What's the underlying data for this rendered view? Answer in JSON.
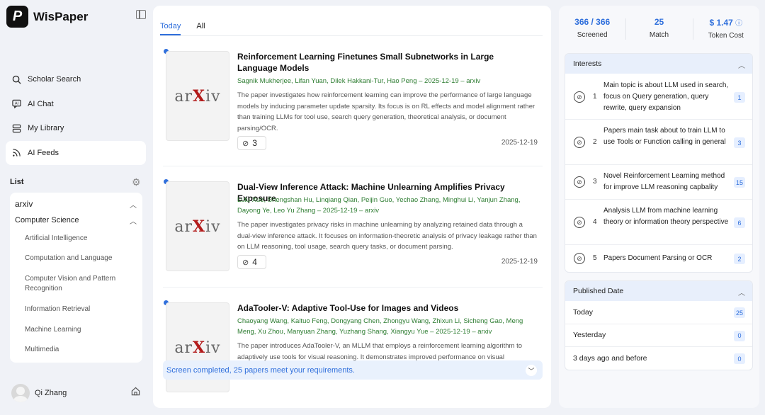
{
  "brand": {
    "logo_letter": "P",
    "name": "WisPaper"
  },
  "nav": [
    {
      "label": "Scholar Search",
      "icon": "search-icon"
    },
    {
      "label": "AI Chat",
      "icon": "chat-icon"
    },
    {
      "label": "My Library",
      "icon": "library-icon"
    },
    {
      "label": "AI Feeds",
      "icon": "rss-icon",
      "active": true
    }
  ],
  "list": {
    "heading": "List",
    "source": "arxiv",
    "category": "Computer Science",
    "subcategories": [
      "Artificial Intelligence",
      "Computation and Language",
      "Computer Vision and Pattern Recognition",
      "Information Retrieval",
      "Machine Learning",
      "Multimedia"
    ]
  },
  "user": {
    "name": "Qi Zhang"
  },
  "tabs": [
    {
      "label": "Today",
      "active": true
    },
    {
      "label": "All",
      "active": false
    }
  ],
  "papers": [
    {
      "thumb": {
        "ar": "ar",
        "x": "X",
        "iv": "iv"
      },
      "title": "Reinforcement Learning Finetunes Small Subnetworks in Large Language Models",
      "authors": "Sagnik Mukherjee, Lifan Yuan, Dilek Hakkani-Tur, Hao Peng – 2025-12-19 – arxiv",
      "abstract": "The paper investigates how reinforcement learning can improve the performance of large language models by inducing parameter update sparsity. Its focus is on RL effects and model alignment rather than training LLMs for tool use, search query generation, theoretical analysis, or document parsing/OCR.",
      "match_count": "3",
      "date": "2025-12-19"
    },
    {
      "thumb": {
        "ar": "ar",
        "x": "X",
        "iv": "iv"
      },
      "title": "Dual-View Inference Attack: Machine Unlearning Amplifies Privacy Exposure",
      "authors": "Lulu Xue, Shengshan Hu, Linqiang Qian, Peijin Guo, Yechao Zhang, Minghui Li, Yanjun Zhang, Dayong Ye, Leo Yu Zhang – 2025-12-19 – arxiv",
      "abstract": "The paper investigates privacy risks in machine unlearning by analyzing retained data through a dual-view inference attack. It focuses on information-theoretic analysis of privacy leakage rather than on LLM reasoning, tool usage, search query tasks, or document parsing.",
      "match_count": "4",
      "date": "2025-12-19"
    },
    {
      "thumb": {
        "ar": "ar",
        "x": "X",
        "iv": "iv"
      },
      "title": "AdaTooler-V: Adaptive Tool-Use for Images and Videos",
      "authors": "Chaoyang Wang, Kaituo Feng, Dongyang Chen, Zhongyu Wang, Zhixun Li, Sicheng Gao, Meng Meng, Xu Zhou, Manyuan Zhang, Yuzhang Shang, Xiangyu Yue – 2025-12-19 – arxiv",
      "abstract": "The paper introduces AdaTooler-V, an MLLM that employs a reinforcement learning algorithm to adaptively use tools for visual reasoning. It demonstrates improved performance on visual"
    }
  ],
  "toast": "Screen completed, 25 papers meet your requirements.",
  "stats": [
    {
      "value": "366 / 366",
      "label": "Screened"
    },
    {
      "value": "25",
      "label": "Match"
    },
    {
      "value": "$ 1.47",
      "label": "Token Cost"
    }
  ],
  "interests": {
    "heading": "Interests",
    "items": [
      {
        "num": "1",
        "text": "Main topic is about LLM used in search, focus on Query generation, query rewrite, query expansion",
        "count": "1"
      },
      {
        "num": "2",
        "text": "Papers main task about to train LLM to use Tools or Function calling in general",
        "count": "3"
      },
      {
        "num": "3",
        "text": "Novel Reinforcement Learning method for improve LLM reasoning capbality",
        "count": "15"
      },
      {
        "num": "4",
        "text": "Analysis LLM from machine learning theory or information theory perspective",
        "count": "6"
      },
      {
        "num": "5",
        "text": "Papers Document Parsing or OCR",
        "count": "2"
      }
    ]
  },
  "published": {
    "heading": "Published Date",
    "items": [
      {
        "label": "Today",
        "count": "25"
      },
      {
        "label": "Yesterday",
        "count": "0"
      },
      {
        "label": "3 days ago and before",
        "count": "0"
      }
    ]
  },
  "colors": {
    "accent": "#2f6fdc",
    "author_green": "#2e7d32",
    "arxiv_red": "#b31b1b"
  }
}
